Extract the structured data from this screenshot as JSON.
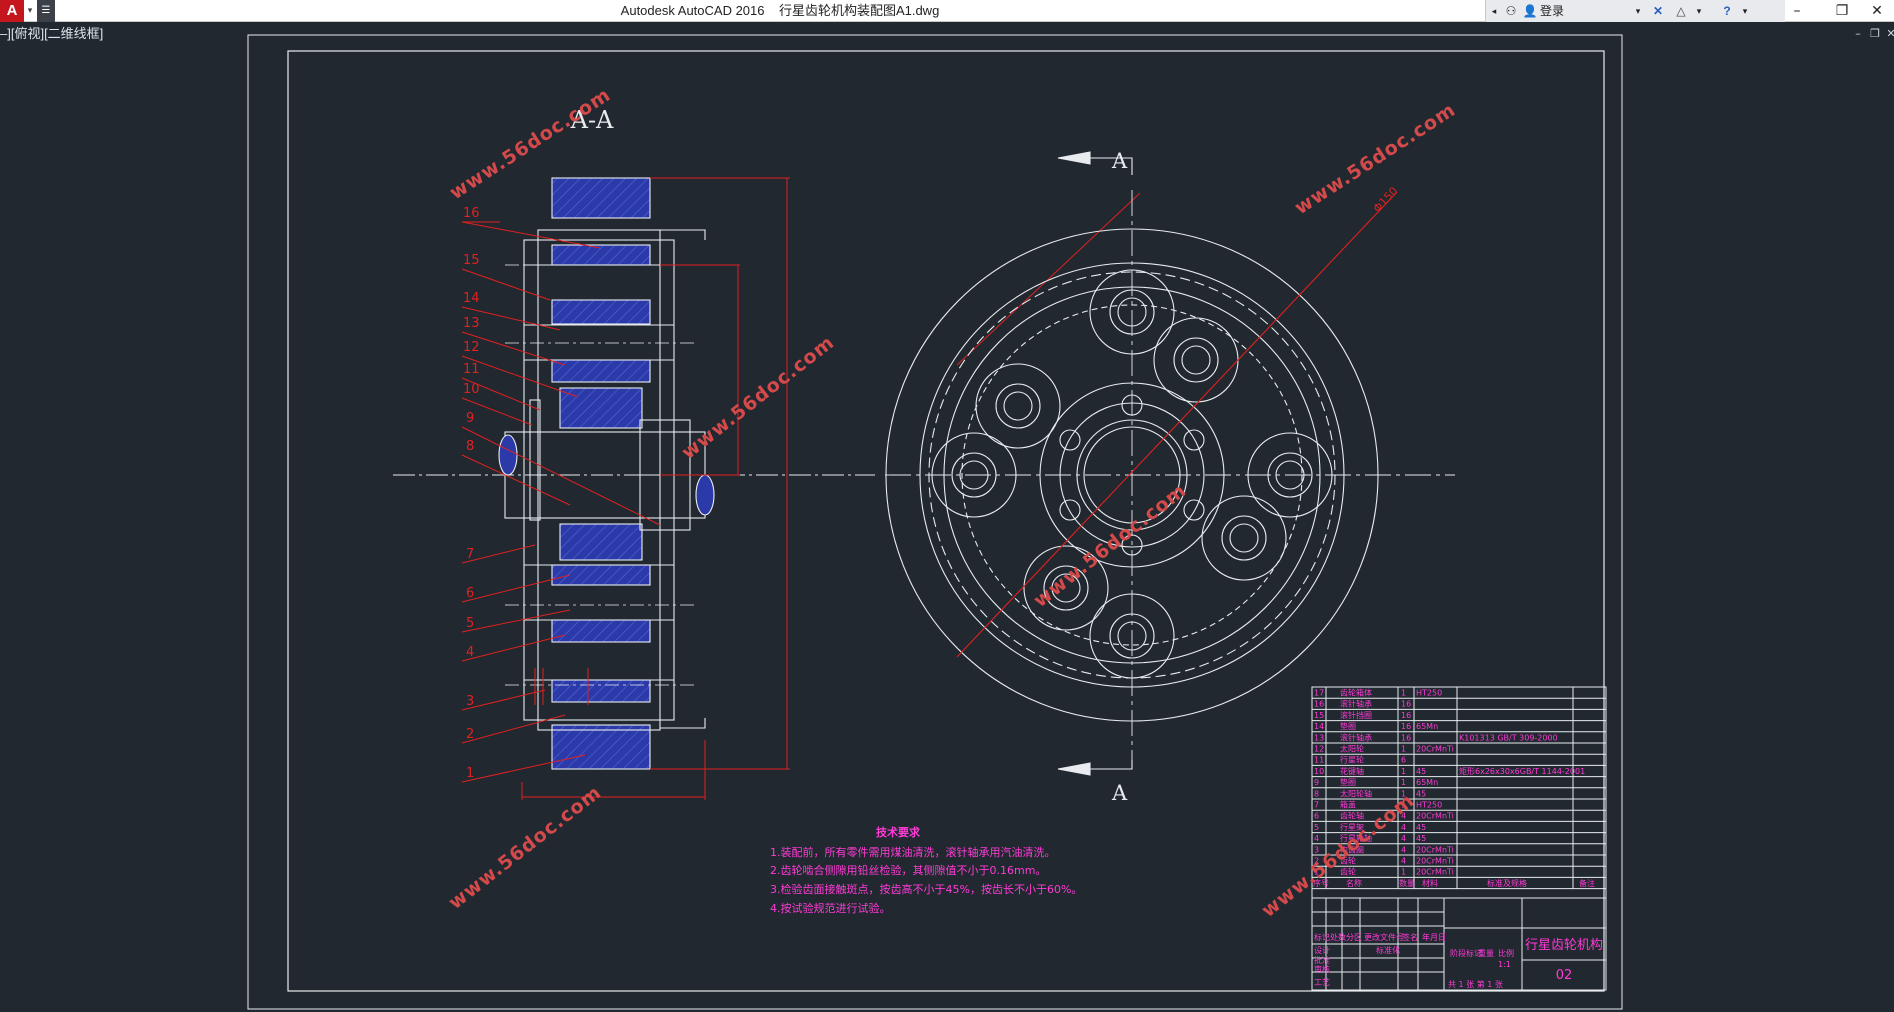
{
  "app": {
    "logo": "A",
    "title": "Autodesk AutoCAD 2016    行星齿轮机构装配图A1.dwg",
    "login": "登录"
  },
  "viewport": {
    "label": "–][俯视][二维线框]"
  },
  "drawing": {
    "section_title": "A-A",
    "cut_label_top": "A",
    "cut_label_bottom": "A",
    "part_numbers": [
      "16",
      "15",
      "14",
      "13",
      "12",
      "11",
      "10",
      "9",
      "8",
      "7",
      "6",
      "5",
      "4",
      "3",
      "2",
      "1"
    ],
    "dimension_label": "Φ150",
    "tech_title": "技术要求",
    "tech_notes": [
      "1.装配前，所有零件需用煤油清洗，滚针轴承用汽油清洗。",
      "2.齿轮啮合侧隙用铅丝检验，其侧隙值不小于0.16mm。",
      "3.检验齿面接触斑点，按齿高不小于45%，按齿长不小于60%。",
      "4.按试验规范进行试验。"
    ]
  },
  "watermark": "www.56doc.com",
  "title_block": {
    "title": "行星齿轮机构",
    "drawing_no": "02",
    "sheet_info": "共 1 张  第 1 张",
    "header": [
      "序号",
      "名称",
      "数量",
      "材料",
      "标准及规格",
      "备注"
    ],
    "rows": [
      [
        "17",
        "齿轮箱体",
        "1",
        "HT250",
        "",
        ""
      ],
      [
        "16",
        "滚针轴承",
        "16",
        "",
        "",
        ""
      ],
      [
        "15",
        "滚针挡圈",
        "16",
        "",
        "",
        ""
      ],
      [
        "14",
        "垫圈",
        "16",
        "65Mn",
        "",
        ""
      ],
      [
        "13",
        "滚针轴承",
        "16",
        "",
        "K101313 GB/T 309-2000",
        ""
      ],
      [
        "12",
        "太阳轮",
        "1",
        "20CrMnTi",
        "",
        ""
      ],
      [
        "11",
        "行星轮",
        "6",
        "",
        "",
        ""
      ],
      [
        "10",
        "花键轴",
        "1",
        "45",
        "矩形6x26x30x6GB/T 1144-2001",
        ""
      ],
      [
        "9",
        "垫圈",
        "1",
        "65Mn",
        "",
        ""
      ],
      [
        "8",
        "太阳轮轴",
        "1",
        "45",
        "",
        ""
      ],
      [
        "7",
        "箱盖",
        "1",
        "HT250",
        "",
        ""
      ],
      [
        "6",
        "齿轮轴",
        "4",
        "20CrMnTi",
        "",
        ""
      ],
      [
        "5",
        "行星架",
        "4",
        "45",
        "",
        ""
      ],
      [
        "4",
        "行星轮轴",
        "4",
        "45",
        "",
        ""
      ],
      [
        "3",
        "内齿圈",
        "4",
        "20CrMnTi",
        "",
        ""
      ],
      [
        "2",
        "齿轮",
        "4",
        "20CrMnTi",
        "",
        ""
      ],
      [
        "1",
        "齿轮",
        "1",
        "20CrMnTi",
        "",
        ""
      ]
    ],
    "sign_labels": [
      "标记",
      "处数",
      "分区",
      "更改文件号",
      "签名",
      "年月日",
      "设计",
      "标准化",
      "审核",
      "工艺",
      "批准",
      "阶段标记",
      "重量",
      "比例"
    ],
    "scale": "1:1"
  },
  "colors": {
    "background": "#212830",
    "lines": "#e8ecef",
    "red": "#e0211f",
    "blue": "#3f4fc4",
    "magenta": "#ff3bd6",
    "watermark": "#d44a4a"
  }
}
